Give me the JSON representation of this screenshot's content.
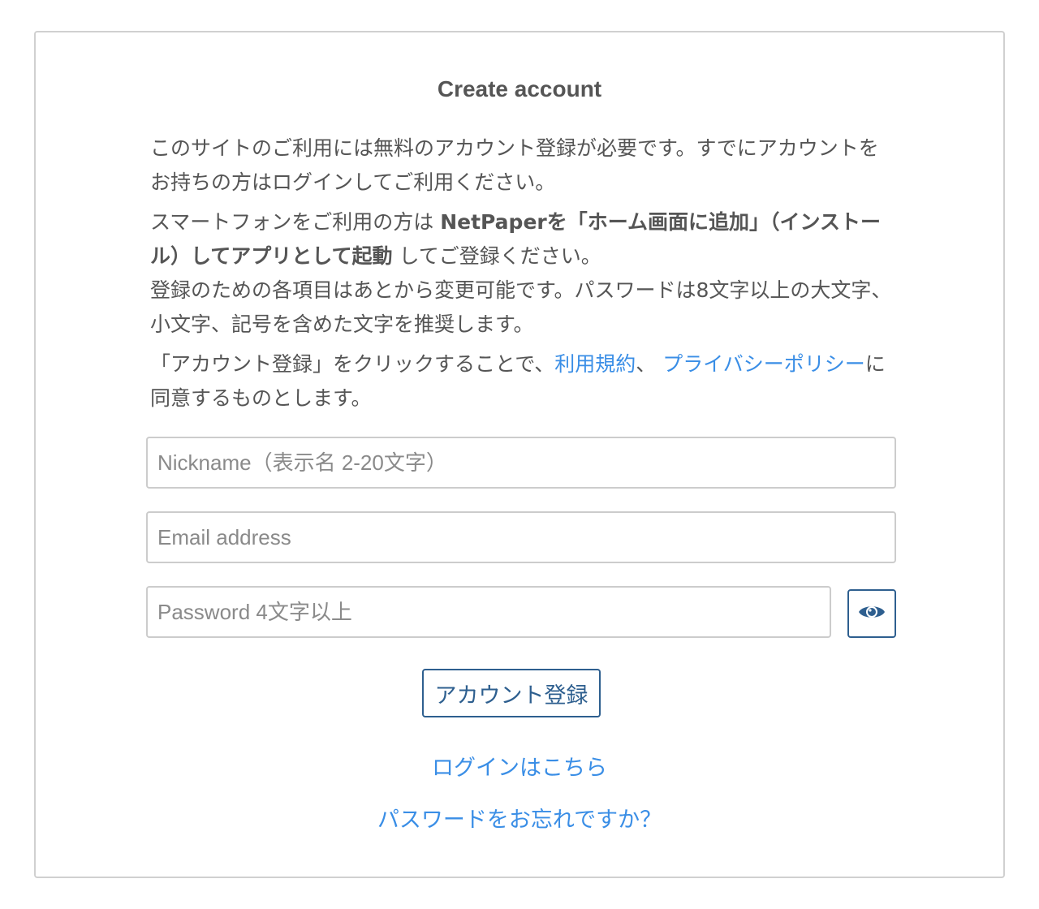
{
  "form": {
    "title": "Create account",
    "intro": {
      "p1": "このサイトのご利用には無料のアカウント登録が必要です。すでにアカウントをお持ちの方はログインしてご利用ください。",
      "p2_prefix": "スマートフォンをご利用の方は ",
      "p2_bold": "NetPaperを「ホーム画面に追加」（インストール）してアプリとして起動",
      "p2_suffix": " してご登録ください。",
      "p3": "登録のための各項目はあとから変更可能です。パスワードは8文字以上の大文字、小文字、記号を含めた文字を推奨します。",
      "p4_prefix": "「アカウント登録」をクリックすることで、",
      "terms_link": "利用規約",
      "p4_sep": "、 ",
      "privacy_link": "プライバシーポリシー",
      "p4_suffix": "に同意するものとします。"
    },
    "nickname": {
      "placeholder": "Nickname（表示名 2-20文字）",
      "value": ""
    },
    "email": {
      "placeholder": "Email address",
      "value": ""
    },
    "password": {
      "placeholder": "Password 4文字以上",
      "value": ""
    },
    "toggle_password_icon": "eye-icon",
    "submit_label": "アカウント登録",
    "login_link": "ログインはこちら",
    "forgot_link": "パスワードをお忘れですか？",
    "colors": {
      "link": "#3a8ee6",
      "button_border": "#2e5f8f",
      "text": "#555555",
      "border": "#cccccc"
    }
  }
}
